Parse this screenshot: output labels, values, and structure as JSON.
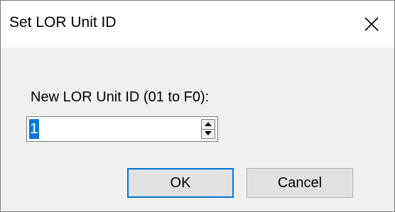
{
  "window": {
    "title": "Set LOR Unit ID"
  },
  "form": {
    "label": "New LOR Unit ID (01 to F0):",
    "unit_id_value": "1"
  },
  "buttons": {
    "ok_label": "OK",
    "cancel_label": "Cancel"
  },
  "colors": {
    "focus": "#0078d7",
    "dialog_bg": "#f0f0f0",
    "title_bg": "#ffffff"
  }
}
